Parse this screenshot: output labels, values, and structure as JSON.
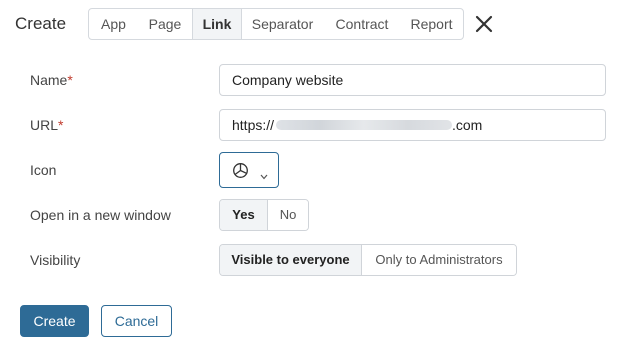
{
  "header": {
    "title": "Create",
    "tabs": [
      {
        "label": "App"
      },
      {
        "label": "Page"
      },
      {
        "label": "Link"
      },
      {
        "label": "Separator"
      },
      {
        "label": "Contract"
      },
      {
        "label": "Report"
      }
    ],
    "active_tab": "Link"
  },
  "form": {
    "name": {
      "label": "Name",
      "required_mark": "*",
      "value": "Company website"
    },
    "url": {
      "label": "URL",
      "required_mark": "*",
      "value_prefix": "https://",
      "value_suffix": ".com"
    },
    "icon": {
      "label": "Icon",
      "selected_icon": "pie-chart-icon"
    },
    "new_window": {
      "label": "Open in a new window",
      "options": [
        "Yes",
        "No"
      ],
      "selected": "Yes"
    },
    "visibility": {
      "label": "Visibility",
      "options": [
        "Visible to everyone",
        "Only to Administrators"
      ],
      "selected": "Visible to everyone"
    }
  },
  "actions": {
    "create_label": "Create",
    "cancel_label": "Cancel"
  },
  "colors": {
    "accent": "#2e6b96",
    "required": "#c0392b",
    "active_bg": "#f2f4f6"
  }
}
